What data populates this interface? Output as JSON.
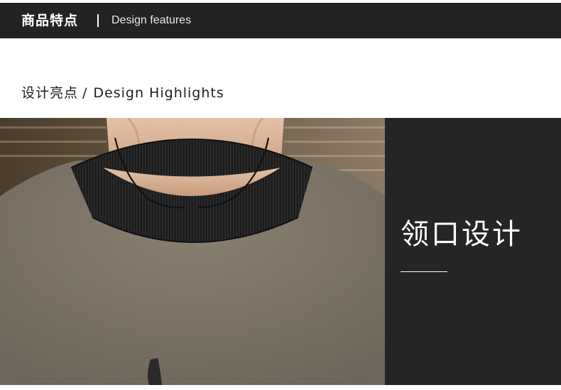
{
  "header": {
    "title_cn": "商品特点",
    "title_en": "Design features"
  },
  "section": {
    "title_cn": "设计亮点",
    "separator": "/",
    "title_en": "Design Highlights"
  },
  "feature": {
    "title": "领口设计"
  },
  "colors": {
    "header_bg": "#232323",
    "panel_bg": "#252525",
    "sweater": "#7d7466",
    "collar": "#1c1c1c"
  }
}
